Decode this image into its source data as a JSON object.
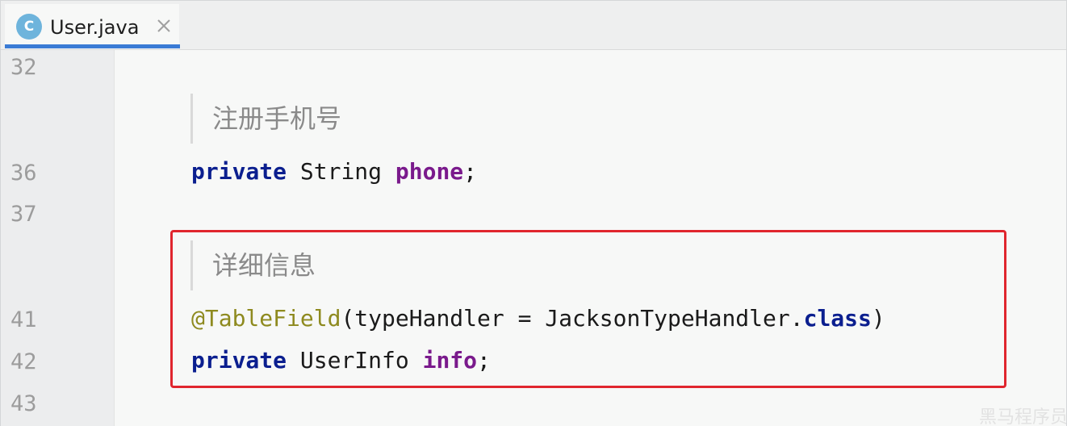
{
  "tab": {
    "icon_letter": "C",
    "filename": "User.java"
  },
  "line_numbers": {
    "l32": "32",
    "l36": "36",
    "l37": "37",
    "l41": "41",
    "l42": "42",
    "l43": "43"
  },
  "code": {
    "comment_phone": "注册手机号",
    "line36": {
      "kw": "private",
      "type": " String ",
      "field": "phone",
      "end": ";"
    },
    "comment_info": "详细信息",
    "line41": {
      "annotation": "@TableField",
      "args": "(typeHandler = JacksonTypeHandler.",
      "kw": "class",
      "end": ")"
    },
    "line42": {
      "kw": "private",
      "type": " UserInfo ",
      "field": "info",
      "end": ";"
    }
  },
  "watermark": "黑马程序员",
  "colors": {
    "keyword": "#0b1f8f",
    "field": "#7a1a8c",
    "annotation": "#8e8a1f",
    "highlight_border": "#e0262e",
    "tab_underline": "#3a7bd5",
    "class_icon": "#6eb4dc"
  }
}
